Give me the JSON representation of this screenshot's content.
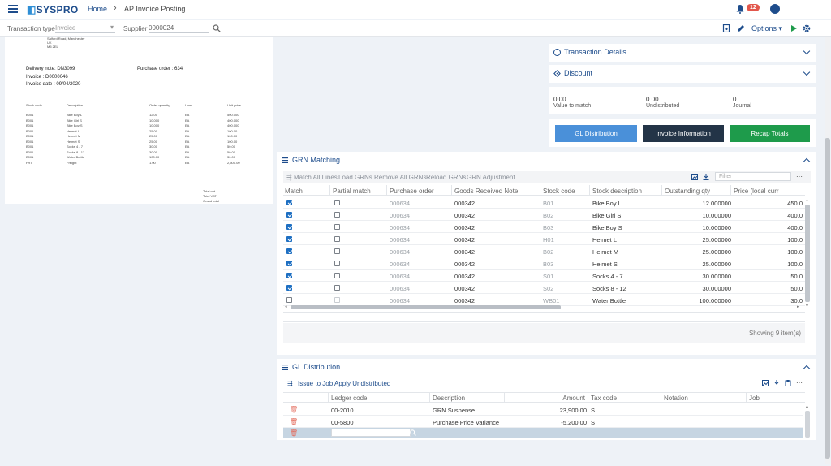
{
  "header": {
    "brand": "SYSPRO",
    "breadcrumb_home": "Home",
    "breadcrumb_sep": "›",
    "page_title": "AP Invoice Posting",
    "notifications_count": "12"
  },
  "subbar": {
    "transaction_type_label": "Transaction type",
    "transaction_type_value": "Invoice",
    "supplier_label": "Supplier",
    "supplier_value": "0000024",
    "options_label": "Options"
  },
  "document": {
    "address_lines": [
      "Salford Road, Manchester",
      "UK",
      "M5 2EL"
    ],
    "delivery_note": "Delivery note: DN3099",
    "purchase_order": "Purchase order : 634",
    "invoice": "Invoice : D0000046",
    "invoice_date": "Invoice date : 09/04/2020",
    "columns": [
      "Stock code",
      "Description",
      "Order quantity",
      "Uom",
      "Unit price"
    ],
    "rows": [
      [
        "B001",
        "Bike Boy L",
        "12.00",
        "EA",
        "500.000"
      ],
      [
        "B001",
        "Bike Girl S",
        "10.000",
        "EA",
        "400.000"
      ],
      [
        "B001",
        "Bike Boy S",
        "10.000",
        "EA",
        "400.000"
      ],
      [
        "B001",
        "Helmet L",
        "25.00",
        "EA",
        "100.00"
      ],
      [
        "B001",
        "Helmet M",
        "25.00",
        "EA",
        "100.00"
      ],
      [
        "B001",
        "Helmet S",
        "25.00",
        "EA",
        "100.00"
      ],
      [
        "B001",
        "Socks 4 - 7",
        "30.00",
        "EA",
        "50.00"
      ],
      [
        "B001",
        "Socks 8 - 12",
        "30.00",
        "EA",
        "50.00"
      ],
      [
        "B001",
        "Water Bottle",
        "100.00",
        "EA",
        "30.00"
      ],
      [
        "FRT",
        "Freight",
        "1.00",
        "EA",
        "2,500.00"
      ]
    ],
    "totals": [
      "Total net",
      "Total VAT",
      "Grand total"
    ]
  },
  "transaction_details": {
    "title": "Transaction Details"
  },
  "discount": {
    "title": "Discount"
  },
  "summary": {
    "value_to_match": "0.00",
    "value_to_match_label": "Value to match",
    "undistributed": "0.00",
    "undistributed_label": "Undistributed",
    "journal": "0",
    "journal_label": "Journal"
  },
  "actions": {
    "gl_distribution": "GL Distribution",
    "invoice_information": "Invoice Information",
    "recap_totals": "Recap Totals"
  },
  "grn_matching": {
    "title": "GRN Matching",
    "toolbar": [
      "Match All Lines",
      "Load GRNs",
      "Remove All GRNs",
      "Reload GRNs",
      "GRN Adjustment"
    ],
    "filter_placeholder": "Filter",
    "columns": [
      "Match",
      "Partial match",
      "Purchase order",
      "Goods Received Note",
      "Stock code",
      "Stock description",
      "Outstanding qty",
      "Price (local curr"
    ],
    "rows": [
      {
        "match": true,
        "po": "000634",
        "grn": "000342",
        "stock": "B01",
        "desc": "Bike Boy L",
        "qty": "12.000000",
        "price": "450.0"
      },
      {
        "match": true,
        "po": "000634",
        "grn": "000342",
        "stock": "B02",
        "desc": "Bike Girl S",
        "qty": "10.000000",
        "price": "400.0"
      },
      {
        "match": true,
        "po": "000634",
        "grn": "000342",
        "stock": "B03",
        "desc": "Bike Boy S",
        "qty": "10.000000",
        "price": "400.0"
      },
      {
        "match": true,
        "po": "000634",
        "grn": "000342",
        "stock": "H01",
        "desc": "Helmet L",
        "qty": "25.000000",
        "price": "100.0"
      },
      {
        "match": true,
        "po": "000634",
        "grn": "000342",
        "stock": "B02",
        "desc": "Helmet M",
        "qty": "25.000000",
        "price": "100.0"
      },
      {
        "match": true,
        "po": "000634",
        "grn": "000342",
        "stock": "B03",
        "desc": "Helmet S",
        "qty": "25.000000",
        "price": "100.0"
      },
      {
        "match": true,
        "po": "000634",
        "grn": "000342",
        "stock": "S01",
        "desc": "Socks 4 - 7",
        "qty": "30.000000",
        "price": "50.0"
      },
      {
        "match": true,
        "po": "000634",
        "grn": "000342",
        "stock": "S02",
        "desc": "Socks 8 - 12",
        "qty": "30.000000",
        "price": "50.0"
      },
      {
        "match": false,
        "po": "000634",
        "grn": "000342",
        "stock": "WB01",
        "desc": "Water Bottle",
        "qty": "100.000000",
        "price": "30.0"
      }
    ],
    "footer": "Showing 9 item(s)"
  },
  "gl_distribution": {
    "title": "GL Distribution",
    "toolbar": [
      "Issue to Job",
      "Apply Undistributed"
    ],
    "columns": [
      "Ledger code",
      "Description",
      "Amount",
      "Tax code",
      "Notation",
      "Job"
    ],
    "rows": [
      {
        "ledger": "00-2010",
        "desc": "GRN Suspense",
        "amount": "23,900.00",
        "tax": "S"
      },
      {
        "ledger": "00-5800",
        "desc": "Purchase Price Variance",
        "amount": "-5,200.00",
        "tax": "S"
      }
    ]
  },
  "colors": {
    "brand": "#1e4d8c",
    "gl_button": "#4a90d9",
    "invoice_button": "#233447",
    "recap_button": "#1e9b4b"
  }
}
